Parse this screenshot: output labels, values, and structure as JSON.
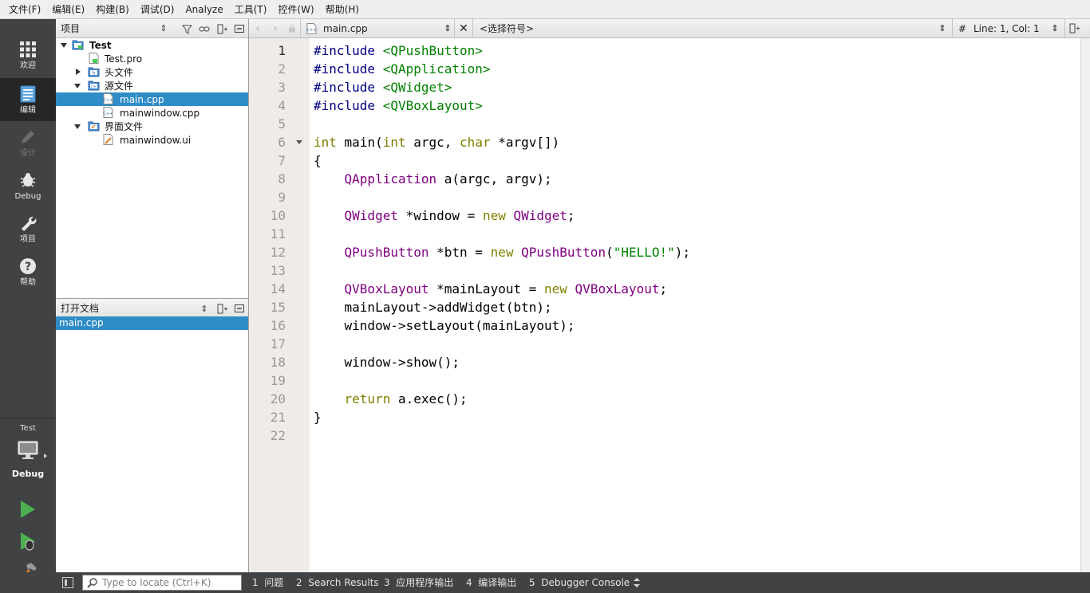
{
  "menubar": {
    "items": [
      "文件(F)",
      "编辑(E)",
      "构建(B)",
      "调试(D)",
      "Analyze",
      "工具(T)",
      "控件(W)",
      "帮助(H)"
    ]
  },
  "modebar": {
    "modes": [
      {
        "label": "欢迎",
        "icon": "grid-icon",
        "state": "normal"
      },
      {
        "label": "编辑",
        "icon": "document-icon",
        "state": "active"
      },
      {
        "label": "设计",
        "icon": "pencil-icon",
        "state": "disabled"
      },
      {
        "label": "Debug",
        "icon": "bug-icon",
        "state": "normal"
      },
      {
        "label": "项目",
        "icon": "wrench-icon",
        "state": "normal"
      },
      {
        "label": "帮助",
        "icon": "help-icon",
        "state": "normal"
      }
    ],
    "kit_project": "Test",
    "kit_build": "Debug"
  },
  "project_panel": {
    "title": "项目",
    "tree": [
      {
        "label": "Test",
        "level": 0,
        "expanded": true,
        "icon": "qt-project-icon",
        "bold": true
      },
      {
        "label": "Test.pro",
        "level": 1,
        "icon": "pro-file-icon"
      },
      {
        "label": "头文件",
        "level": 1,
        "expanded": false,
        "icon": "header-folder-icon"
      },
      {
        "label": "源文件",
        "level": 1,
        "expanded": true,
        "icon": "source-folder-icon"
      },
      {
        "label": "main.cpp",
        "level": 2,
        "icon": "cpp-file-icon",
        "selected": true
      },
      {
        "label": "mainwindow.cpp",
        "level": 2,
        "icon": "cpp-file-icon"
      },
      {
        "label": "界面文件",
        "level": 1,
        "expanded": true,
        "icon": "form-folder-icon"
      },
      {
        "label": "mainwindow.ui",
        "level": 2,
        "icon": "ui-file-icon"
      }
    ]
  },
  "open_docs_panel": {
    "title": "打开文档",
    "documents": [
      "main.cpp"
    ]
  },
  "editor_toolbar": {
    "file_name": "main.cpp",
    "symbol_placeholder": "<选择符号>",
    "hash": "#",
    "position": "Line: 1, Col: 1"
  },
  "editor": {
    "current_line": 1,
    "line_numbers": [
      "1",
      "2",
      "3",
      "4",
      "5",
      "6",
      "7",
      "8",
      "9",
      "10",
      "11",
      "12",
      "13",
      "14",
      "15",
      "16",
      "17",
      "18",
      "19",
      "20",
      "21",
      "22"
    ],
    "lines": [
      [
        {
          "t": "#include ",
          "c": "p"
        },
        {
          "t": "<QPushButton>",
          "c": "i"
        }
      ],
      [
        {
          "t": "#include ",
          "c": "p"
        },
        {
          "t": "<QApplication>",
          "c": "i"
        }
      ],
      [
        {
          "t": "#include ",
          "c": "p"
        },
        {
          "t": "<QWidget>",
          "c": "i"
        }
      ],
      [
        {
          "t": "#include ",
          "c": "p"
        },
        {
          "t": "<QVBoxLayout>",
          "c": "i"
        }
      ],
      [],
      [
        {
          "t": "int",
          "c": "k"
        },
        {
          "t": " main(",
          "c": ""
        },
        {
          "t": "int",
          "c": "k"
        },
        {
          "t": " argc, ",
          "c": ""
        },
        {
          "t": "char",
          "c": "k"
        },
        {
          "t": " *argv[])",
          "c": ""
        }
      ],
      [
        {
          "t": "{",
          "c": ""
        }
      ],
      [
        {
          "t": "    ",
          "c": ""
        },
        {
          "t": "QApplication",
          "c": "c"
        },
        {
          "t": " a(argc, argv);",
          "c": ""
        }
      ],
      [],
      [
        {
          "t": "    ",
          "c": ""
        },
        {
          "t": "QWidget",
          "c": "c"
        },
        {
          "t": " *window = ",
          "c": ""
        },
        {
          "t": "new",
          "c": "k"
        },
        {
          "t": " ",
          "c": ""
        },
        {
          "t": "QWidget",
          "c": "c"
        },
        {
          "t": ";",
          "c": ""
        }
      ],
      [],
      [
        {
          "t": "    ",
          "c": ""
        },
        {
          "t": "QPushButton",
          "c": "c"
        },
        {
          "t": " *btn = ",
          "c": ""
        },
        {
          "t": "new",
          "c": "k"
        },
        {
          "t": " ",
          "c": ""
        },
        {
          "t": "QPushButton",
          "c": "c"
        },
        {
          "t": "(",
          "c": ""
        },
        {
          "t": "\"HELLO!\"",
          "c": "s"
        },
        {
          "t": ");",
          "c": ""
        }
      ],
      [],
      [
        {
          "t": "    ",
          "c": ""
        },
        {
          "t": "QVBoxLayout",
          "c": "c"
        },
        {
          "t": " *mainLayout = ",
          "c": ""
        },
        {
          "t": "new",
          "c": "k"
        },
        {
          "t": " ",
          "c": ""
        },
        {
          "t": "QVBoxLayout",
          "c": "c"
        },
        {
          "t": ";",
          "c": ""
        }
      ],
      [
        {
          "t": "    mainLayout->addWidget(btn);",
          "c": ""
        }
      ],
      [
        {
          "t": "    window->setLayout(mainLayout);",
          "c": ""
        }
      ],
      [],
      [
        {
          "t": "    window->show();",
          "c": ""
        }
      ],
      [],
      [
        {
          "t": "    ",
          "c": ""
        },
        {
          "t": "return",
          "c": "k"
        },
        {
          "t": " a.exec();",
          "c": ""
        }
      ],
      [
        {
          "t": "}",
          "c": ""
        }
      ],
      []
    ]
  },
  "statusbar": {
    "locator_placeholder": "Type to locate (Ctrl+K)",
    "panes": [
      {
        "num": "1",
        "label": "问题"
      },
      {
        "num": "2",
        "label": "Search Results"
      },
      {
        "num": "3",
        "label": "应用程序输出"
      },
      {
        "num": "4",
        "label": "编译输出"
      },
      {
        "num": "5",
        "label": "Debugger Console"
      }
    ]
  }
}
